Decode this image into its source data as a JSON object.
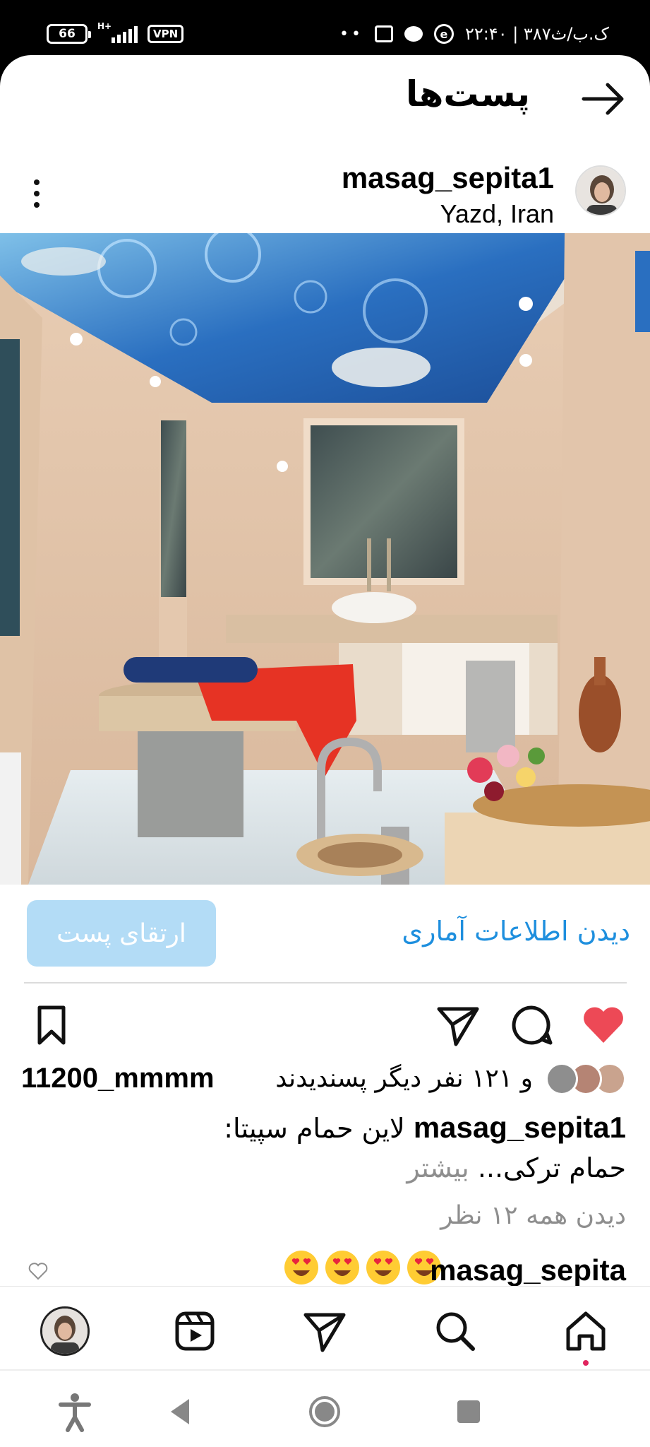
{
  "status_bar": {
    "battery": "66",
    "network": "H+",
    "vpn": "VPN",
    "time": "۲۲:۴۰ | ۳۸۷ک.ب/ث"
  },
  "header": {
    "title": "پست‌ها"
  },
  "post": {
    "username": "masag_sepita1",
    "location": "Yazd, Iran",
    "boost_label": "ارتقای پست",
    "insights_label": "دیدن اطلاعات آماری",
    "likes_prefix": "و ۱۲۱ نفر دیگر پسندیدند",
    "liked_by": "11200_mmmm",
    "caption_user": "masag_sepita1",
    "caption_text": "لاین حمام سپیتا:",
    "caption_line2": "حمام ترکی...",
    "caption_more": "بیشتر",
    "view_comments": "دیدن همه ۱۲ نظر",
    "comment_user": "masag_sepita"
  },
  "colors": {
    "like_red": "#ed4956",
    "link_blue": "#1e8fde",
    "boost_bg": "#b3dcf6"
  },
  "icons": {
    "back": "arrow-right-icon",
    "more": "more-vertical-icon",
    "like": "heart-icon",
    "comment": "comment-icon",
    "share": "send-icon",
    "save": "bookmark-icon"
  }
}
